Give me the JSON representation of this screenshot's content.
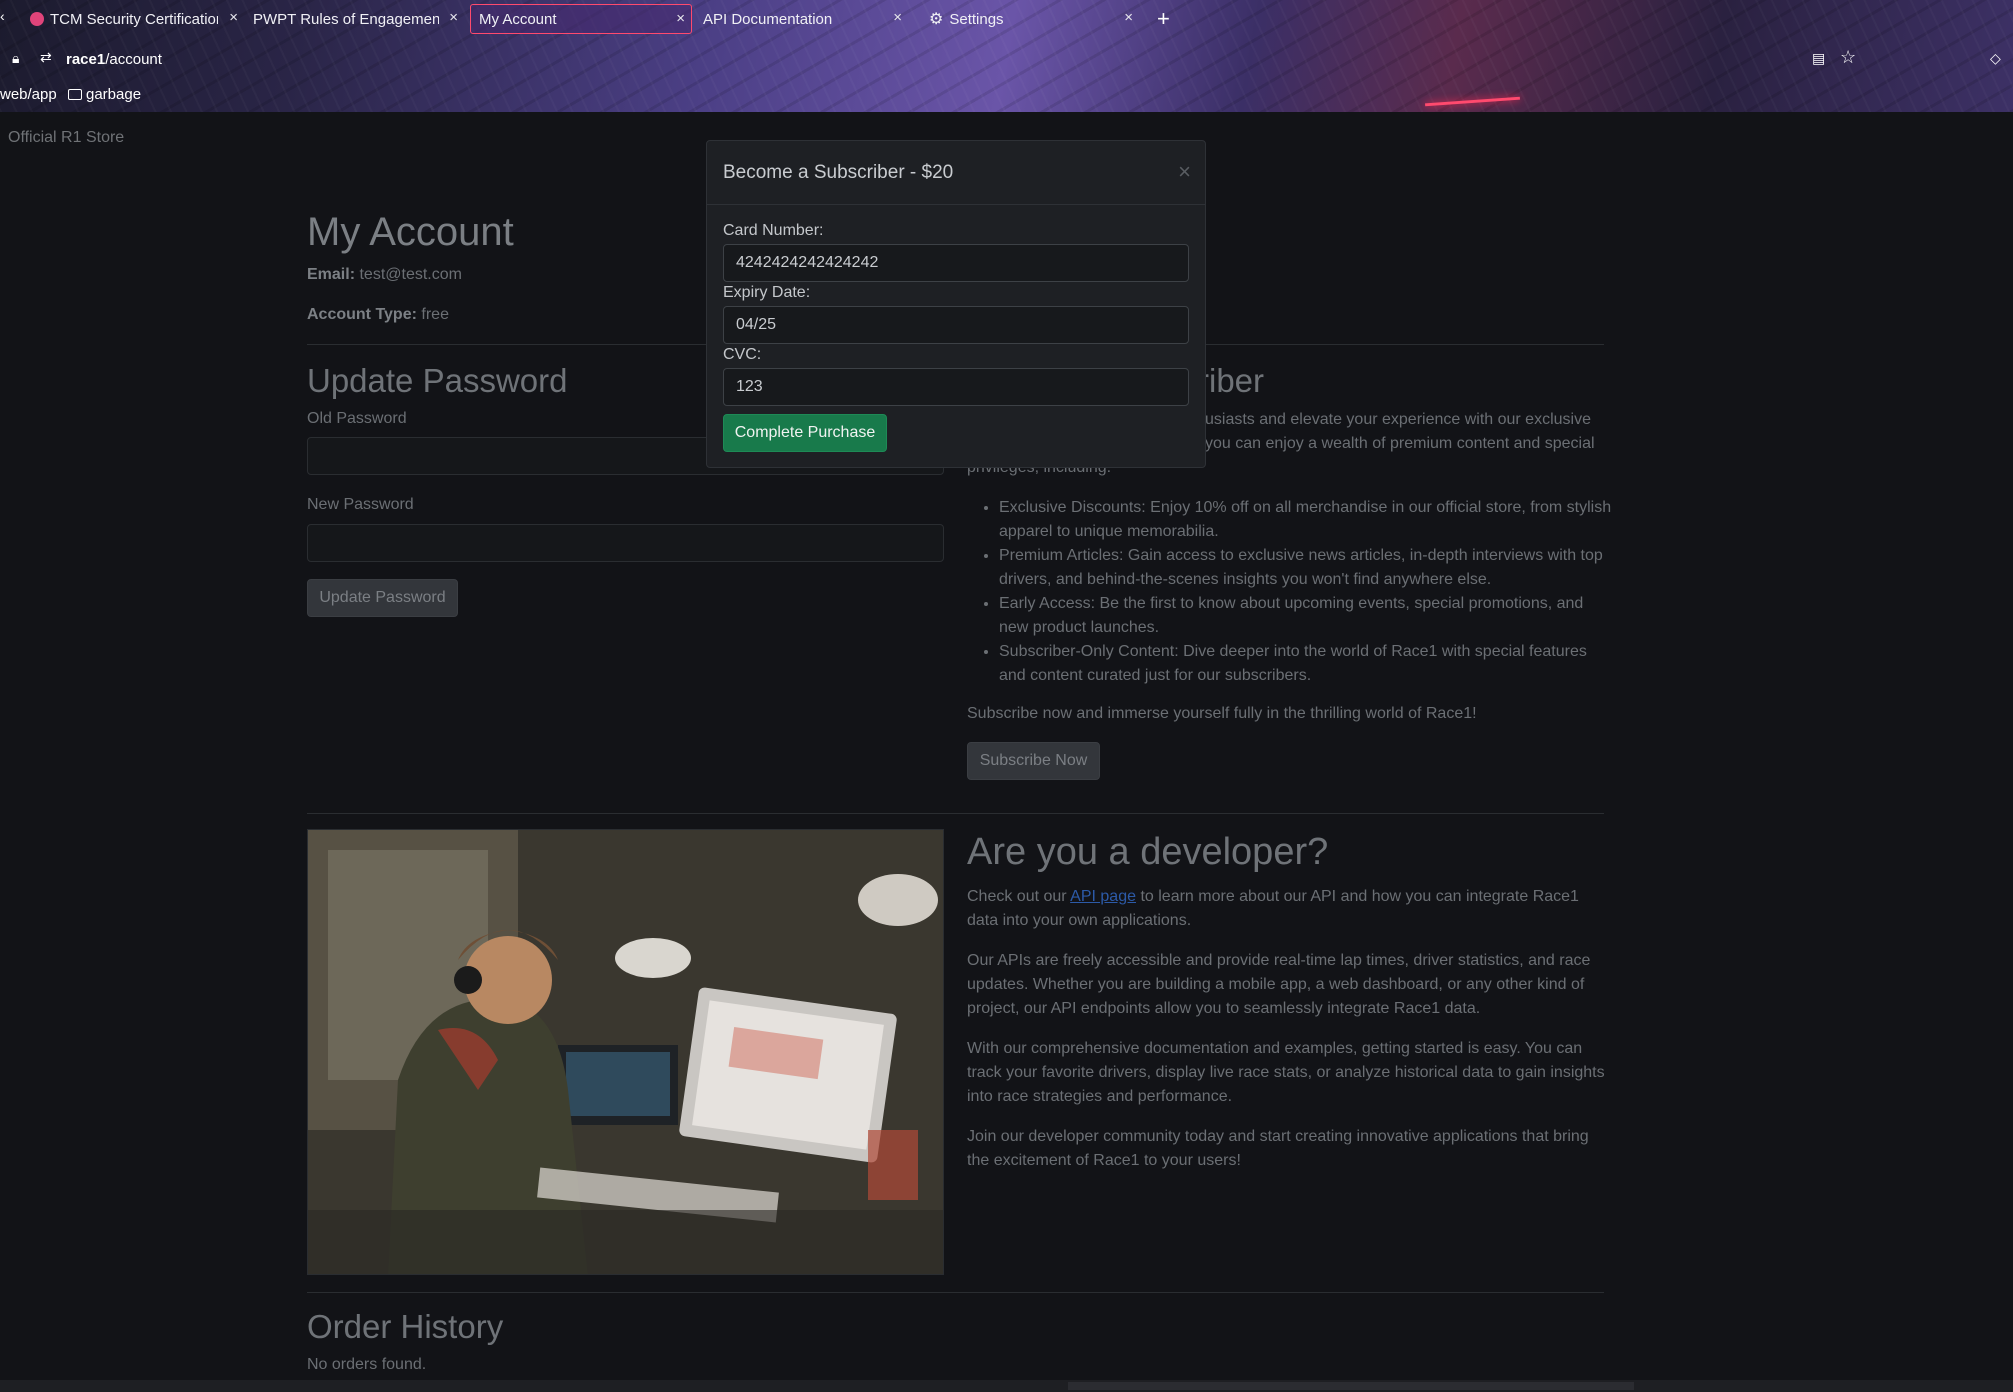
{
  "browser": {
    "tabs": [
      {
        "label": "TCM Security Certification",
        "close": "×"
      },
      {
        "label": "PWPT Rules of Engagement",
        "close": "×"
      },
      {
        "label": "My Account",
        "close": "×",
        "active": true
      },
      {
        "label": "API Documentation",
        "close": "×"
      },
      {
        "label": "Settings",
        "close": "×"
      }
    ],
    "new_tab": "+",
    "back_arrow": "‹",
    "url_host": "race1",
    "url_path": "/account",
    "bookmarks": [
      {
        "label": "web/app"
      },
      {
        "label": "garbage"
      }
    ],
    "icons": [
      "lock-icon",
      "permissions-icon",
      "reader-mode-icon",
      "bookmark-star-icon",
      "pocket-icon",
      "gear-icon",
      "folder-icon"
    ]
  },
  "site": {
    "brand": "Official R1 Store"
  },
  "account": {
    "title": "My Account",
    "email_label": "Email:",
    "email_value": "test@test.com",
    "type_label": "Account Type:",
    "type_value": "free"
  },
  "update_password": {
    "title": "Update Password",
    "old_label": "Old Password",
    "new_label": "New Password",
    "button": "Update Password"
  },
  "subscriber": {
    "title_visible": "riber",
    "intro_line1": "usiasts and elevate your experience with our exclusive",
    "intro_line2": "you can enjoy a wealth of premium content and special",
    "intro_line3": "privileges, including:",
    "benefits": [
      "Exclusive Discounts: Enjoy 10% off on all merchandise in our official store, from stylish apparel to unique memorabilia.",
      "Premium Articles: Gain access to exclusive news articles, in-depth interviews with top drivers, and behind-the-scenes insights you won't find anywhere else.",
      "Early Access: Be the first to know about upcoming events, special promotions, and new product launches.",
      "Subscriber-Only Content: Dive deeper into the world of Race1 with special features and content curated just for our subscribers."
    ],
    "cta_text": "Subscribe now and immerse yourself fully in the thrilling world of Race1!",
    "button": "Subscribe Now"
  },
  "developer": {
    "title": "Are you a developer?",
    "p1_before": "Check out our ",
    "p1_link": "API page",
    "p1_after": " to learn more about our API and how you can integrate Race1 data into your own applications.",
    "p2": "Our APIs are freely accessible and provide real-time lap times, driver statistics, and race updates. Whether you are building a mobile app, a web dashboard, or any other kind of project, our API endpoints allow you to seamlessly integrate Race1 data.",
    "p3": "With our comprehensive documentation and examples, getting started is easy. You can track your favorite drivers, display live race stats, or analyze historical data to gain insights into race strategies and performance.",
    "p4": "Join our developer community today and start creating innovative applications that bring the excitement of Race1 to your users!"
  },
  "orders": {
    "title": "Order History",
    "empty": "No orders found."
  },
  "modal": {
    "title": "Become a Subscriber - $20",
    "close": "×",
    "card_label": "Card Number:",
    "card_value": "4242424242424242",
    "expiry_label": "Expiry Date:",
    "expiry_value": "04/25",
    "cvc_label": "CVC:",
    "cvc_value": "123",
    "submit": "Complete Purchase"
  },
  "colors": {
    "accent_success": "#187a4b",
    "link": "#2c5aa8",
    "active_tab_border": "#ff4a6e",
    "page_bg": "#121317"
  }
}
